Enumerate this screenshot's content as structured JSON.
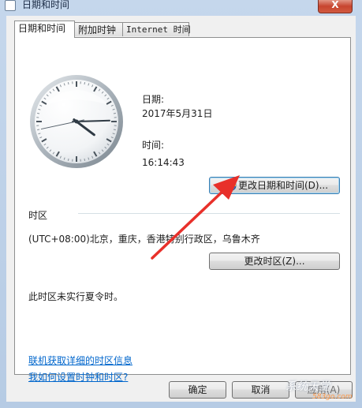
{
  "window": {
    "title": "日期和时间",
    "close": "X"
  },
  "tabs": [
    "日期和时间",
    "附加时钟",
    "Internet 时间"
  ],
  "date": {
    "label": "日期:",
    "value": "2017年5月31日"
  },
  "time": {
    "label": "时间:",
    "value": "16:14:43"
  },
  "buttons": {
    "change_datetime": "更改日期和时间(D)...",
    "change_timezone": "更改时区(Z)...",
    "ok": "确定",
    "cancel": "取消",
    "apply": "应用(A)"
  },
  "timezone": {
    "section_label": "时区",
    "value": "(UTC+08:00)北京，重庆，香港特别行政区，乌鲁木齐",
    "dst_note": "此时区未实行夏令时。"
  },
  "links": {
    "online_info": "联机获取详细的时区信息",
    "how_to_set": "我如何设置时钟和时区?"
  },
  "watermark": {
    "text": "系统天堂",
    "site": "583go.com"
  },
  "clock": {
    "hour": 16,
    "minute": 14,
    "second": 43
  },
  "colors": {
    "link": "#0066cc",
    "arrow": "#e8302a"
  },
  "icons": {
    "shield": "uac-shield-icon"
  }
}
